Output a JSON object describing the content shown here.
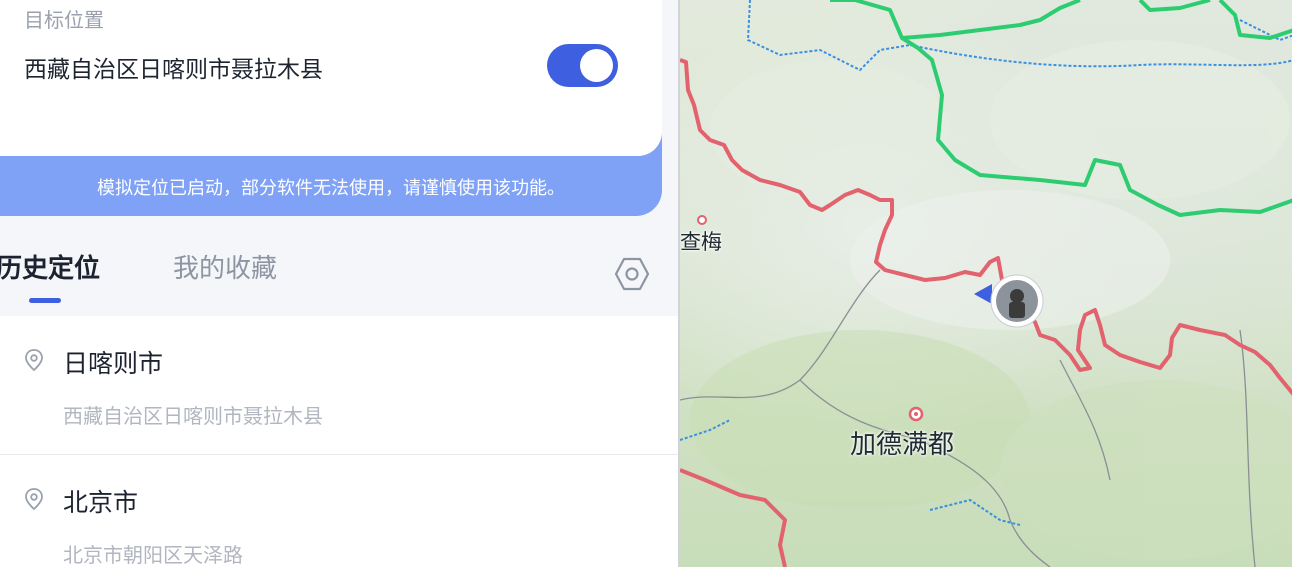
{
  "target": {
    "label": "目标位置",
    "value": "西藏自治区日喀则市聂拉木县",
    "toggle_on": true
  },
  "banner": "模拟定位已启动，部分软件无法使用，请谨慎使用该功能。",
  "tabs": [
    {
      "label": "历史定位",
      "active": true
    },
    {
      "label": "我的收藏",
      "active": false
    }
  ],
  "history": [
    {
      "title": "日喀则市",
      "address": "西藏自治区日喀则市聂拉木县"
    },
    {
      "title": "北京市",
      "address": "北京市朝阳区天泽路"
    }
  ],
  "map": {
    "labels": [
      {
        "text": "查梅"
      },
      {
        "text": "加德满都"
      }
    ]
  },
  "colors": {
    "accent": "#3d5fe0",
    "banner": "#7fa2f7",
    "border_red": "#e2626e",
    "border_green": "#2ecc71",
    "river": "#3a8fe0"
  }
}
